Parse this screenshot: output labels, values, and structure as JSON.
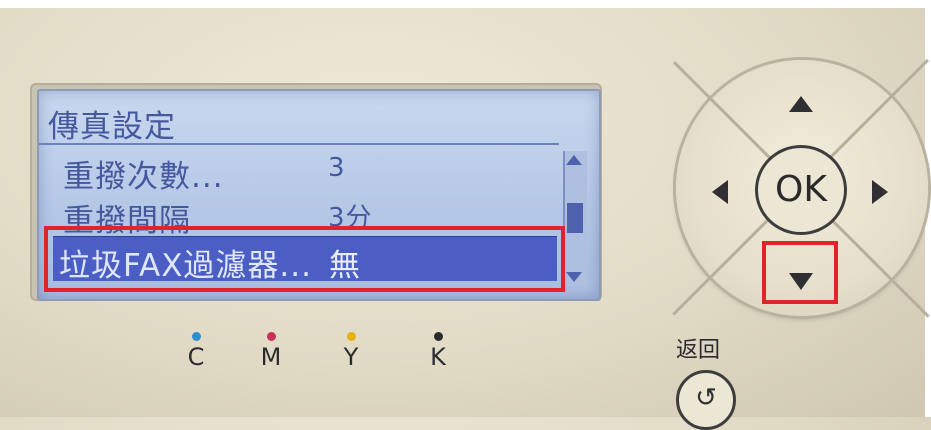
{
  "lcd": {
    "title": "傳真設定",
    "rows": [
      {
        "label": "重撥次數...",
        "value": "3"
      },
      {
        "label": "重撥間隔",
        "value": "3分"
      },
      {
        "label": "垃圾FAX過濾器...",
        "value": "無"
      }
    ],
    "selected_index": 2
  },
  "inks": [
    {
      "letter": "C",
      "color": "#2a8fd0"
    },
    {
      "letter": "M",
      "color": "#c8305a"
    },
    {
      "letter": "Y",
      "color": "#e3b10a"
    },
    {
      "letter": "K",
      "color": "#2a2a2a"
    }
  ],
  "nav": {
    "ok_label": "OK",
    "up_icon": "arrow-up-icon",
    "down_icon": "arrow-down-icon",
    "left_icon": "arrow-left-icon",
    "right_icon": "arrow-right-icon"
  },
  "back": {
    "label": "返回",
    "icon": "back-arrow-icon",
    "glyph": "↺"
  },
  "colors": {
    "lcd_text": "#45589e",
    "lcd_highlight": "#4a5ec4",
    "annotation_red": "#e0242a"
  }
}
